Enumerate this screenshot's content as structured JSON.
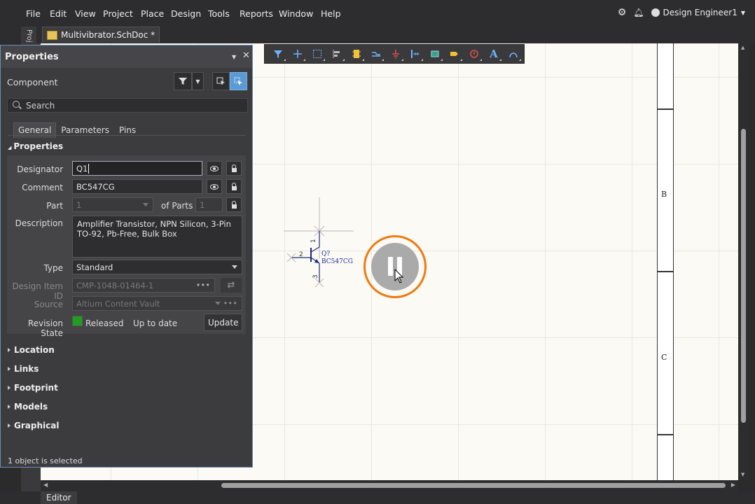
{
  "menubar": {
    "items": [
      "File",
      "Edit",
      "View",
      "Project",
      "Place",
      "Design",
      "Tools",
      "Reports",
      "Window",
      "Help"
    ],
    "user": "Design Engineer1"
  },
  "tabs": {
    "side_panel": "Proj",
    "document": "Multivibrator.SchDoc *"
  },
  "bottom": {
    "editor_tab": "Editor"
  },
  "sheet": {
    "zones": [
      "B",
      "C"
    ]
  },
  "panel": {
    "title": "Properties",
    "object_type": "Component",
    "search_placeholder": "Search",
    "tabs": [
      "General",
      "Parameters",
      "Pins"
    ],
    "section_properties": "Properties",
    "fields": {
      "designator_label": "Designator",
      "designator_value": "Q1",
      "comment_label": "Comment",
      "comment_value": "BC547CG",
      "part_label": "Part",
      "part_value": "1",
      "of_parts_label": "of Parts",
      "of_parts_value": "1",
      "description_label": "Description",
      "description_value": "Amplifier Transistor, NPN Silicon, 3-Pin TO-92, Pb-Free, Bulk Box",
      "type_label": "Type",
      "type_value": "Standard",
      "design_item_label": "Design Item ID",
      "design_item_value": "CMP-1048-01464-1",
      "source_label": "Source",
      "source_value": "Altium Content Vault",
      "revision_label": "Revision State",
      "revision_state": "Released",
      "revision_status": "Up to date",
      "update_button": "Update",
      "revision_color": "#1f9e1f"
    },
    "sections": [
      "Location",
      "Links",
      "Footprint",
      "Models",
      "Graphical"
    ],
    "footer": "1 object is selected"
  },
  "schematic": {
    "designator": "Q?",
    "comment": "BC547CG",
    "pins": [
      "1",
      "2",
      "3"
    ]
  },
  "overlay": {
    "state": "paused",
    "ring_color": "#f07a10"
  }
}
